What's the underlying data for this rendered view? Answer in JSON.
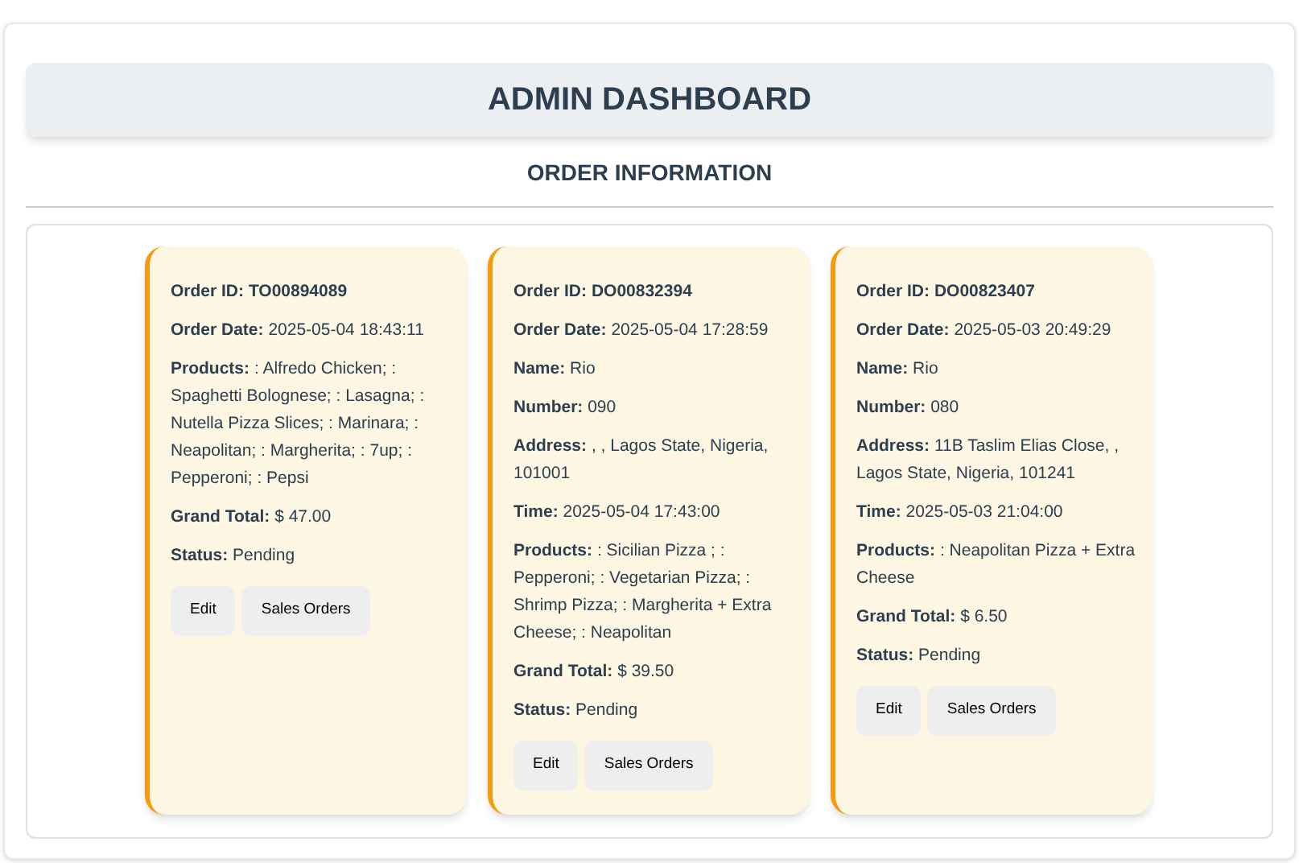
{
  "header": {
    "title": "ADMIN DASHBOARD"
  },
  "section_title": "ORDER INFORMATION",
  "orders": [
    {
      "fields": [
        {
          "label": "Order ID:",
          "value": "TO00894089",
          "bold_value": true
        },
        {
          "label": "Order Date:",
          "value": "2025-05-04 18:43:11"
        },
        {
          "label": "Products:",
          "value": ": Alfredo Chicken; : Spaghetti Bolognese; : Lasagna; : Nutella Pizza Slices; : Marinara; : Neapolitan; : Margherita; : 7up; : Pepperoni; : Pepsi"
        },
        {
          "label": "Grand Total:",
          "value": "$ 47.00"
        },
        {
          "label": "Status:",
          "value": "Pending"
        }
      ],
      "buttons": [
        "Edit",
        "Sales Orders"
      ]
    },
    {
      "fields": [
        {
          "label": "Order ID:",
          "value": "DO00832394",
          "bold_value": true
        },
        {
          "label": "Order Date:",
          "value": "2025-05-04 17:28:59"
        },
        {
          "label": "Name:",
          "value": "Rio"
        },
        {
          "label": "Number:",
          "value": "090"
        },
        {
          "label": "Address:",
          "value": ", , Lagos State, Nigeria, 101001"
        },
        {
          "label": "Time:",
          "value": "2025-05-04 17:43:00"
        },
        {
          "label": "Products:",
          "value": ": Sicilian Pizza ; : Pepperoni; : Vegetarian Pizza; : Shrimp Pizza; : Margherita + Extra Cheese; : Neapolitan"
        },
        {
          "label": "Grand Total:",
          "value": "$ 39.50"
        },
        {
          "label": "Status:",
          "value": "Pending"
        }
      ],
      "buttons": [
        "Edit",
        "Sales Orders"
      ]
    },
    {
      "fields": [
        {
          "label": "Order ID:",
          "value": "DO00823407",
          "bold_value": true
        },
        {
          "label": "Order Date:",
          "value": "2025-05-03 20:49:29"
        },
        {
          "label": "Name:",
          "value": "Rio"
        },
        {
          "label": "Number:",
          "value": "080"
        },
        {
          "label": "Address:",
          "value": "11B Taslim Elias Close, , Lagos State, Nigeria, 101241"
        },
        {
          "label": "Time:",
          "value": "2025-05-03 21:04:00"
        },
        {
          "label": "Products:",
          "value": ": Neapolitan Pizza + Extra Cheese"
        },
        {
          "label": "Grand Total:",
          "value": "$ 6.50"
        },
        {
          "label": "Status:",
          "value": "Pending"
        }
      ],
      "buttons": [
        "Edit",
        "Sales Orders"
      ]
    }
  ]
}
